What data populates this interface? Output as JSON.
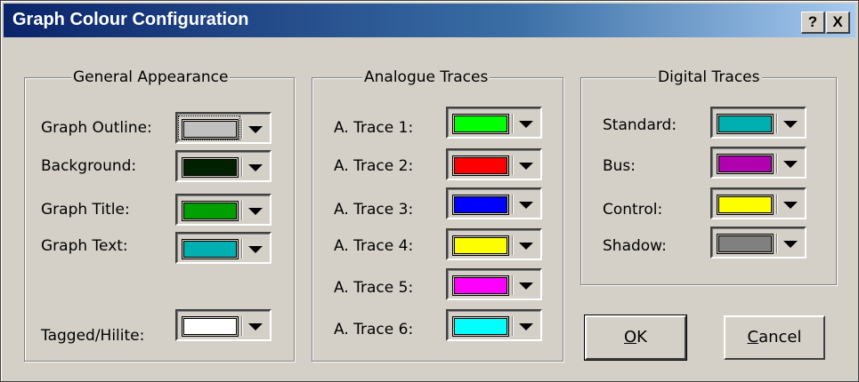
{
  "window": {
    "title": "Graph Colour Configuration",
    "help_label": "?",
    "close_label": "X"
  },
  "general": {
    "legend": "General Appearance",
    "items": [
      {
        "label": "Graph Outline:",
        "color": "#c0c0c0",
        "focused": true
      },
      {
        "label": "Background:",
        "color": "#002000"
      },
      {
        "label": "Graph Title:",
        "color": "#00a000"
      },
      {
        "label": "Graph Text:",
        "color": "#00b0b0"
      },
      {
        "label": "Tagged/Hilite:",
        "color": "#ffffff"
      }
    ]
  },
  "analogue": {
    "legend": "Analogue Traces",
    "items": [
      {
        "label": "A. Trace 1:",
        "color": "#00ff00"
      },
      {
        "label": "A. Trace 2:",
        "color": "#ff0000"
      },
      {
        "label": "A. Trace 3:",
        "color": "#0000ff"
      },
      {
        "label": "A. Trace 4:",
        "color": "#ffff00"
      },
      {
        "label": "A. Trace 5:",
        "color": "#ff00ff"
      },
      {
        "label": "A. Trace 6:",
        "color": "#00ffff"
      }
    ]
  },
  "digital": {
    "legend": "Digital Traces",
    "items": [
      {
        "label": "Standard:",
        "color": "#00b0b0"
      },
      {
        "label": "Bus:",
        "color": "#b000b0"
      },
      {
        "label": "Control:",
        "color": "#ffff00"
      },
      {
        "label": "Shadow:",
        "color": "#808080"
      }
    ]
  },
  "buttons": {
    "ok_label": "OK",
    "ok_mnemonic": "O",
    "ok_rest": "K",
    "cancel_label": "Cancel",
    "cancel_mnemonic": "C",
    "cancel_rest": "ancel"
  },
  "icons": {
    "dropdown": "chevron-down-icon",
    "help": "help-icon",
    "close": "close-icon"
  }
}
